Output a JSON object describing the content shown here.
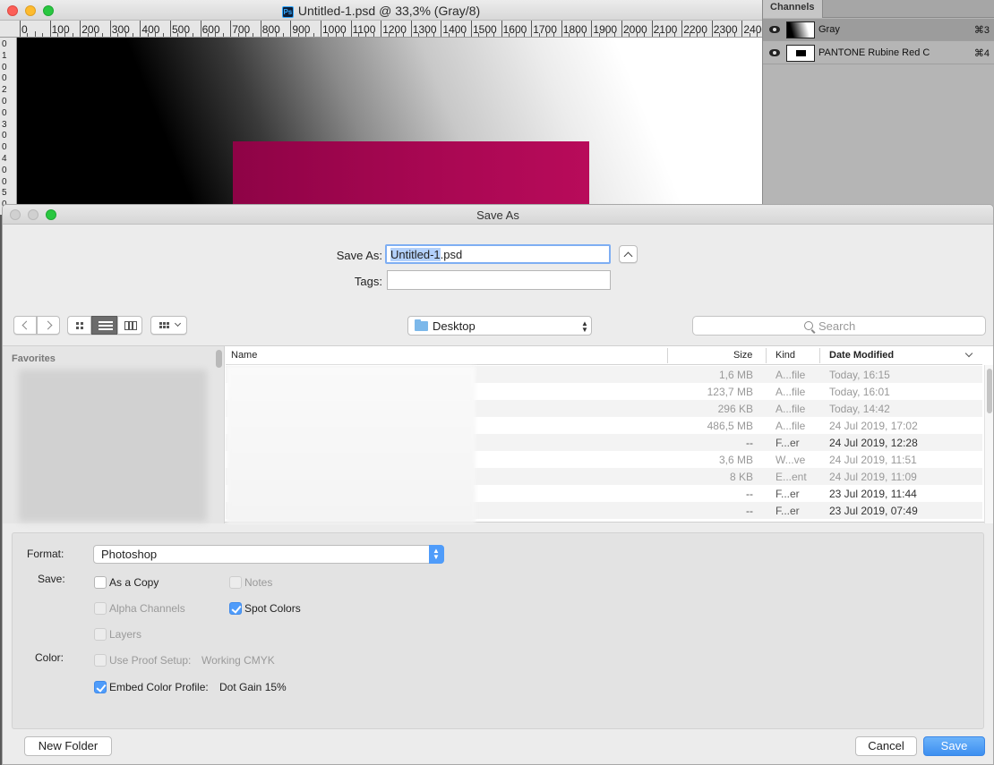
{
  "ps_window": {
    "title": "Untitled-1.psd @ 33,3% (Gray/8)",
    "app_icon_text": "Ps",
    "ruler_top": [
      "0",
      "100",
      "200",
      "300",
      "400",
      "500",
      "600",
      "700",
      "800",
      "900",
      "1000",
      "1100",
      "1200",
      "1300",
      "1400",
      "1500",
      "1600",
      "1700",
      "1800",
      "1900",
      "2000",
      "2100",
      "2200",
      "2300",
      "2400"
    ],
    "ruler_left": [
      "0",
      "1",
      "0",
      "0",
      "2",
      "0",
      "0",
      "3",
      "0",
      "0",
      "4",
      "0",
      "0",
      "5",
      "0"
    ],
    "spot_color": "#a80752"
  },
  "channels_panel": {
    "tab": "Channels",
    "rows": [
      {
        "name": "Gray",
        "shortcut": "⌘3"
      },
      {
        "name": "PANTONE Rubine Red C",
        "shortcut": "⌘4"
      }
    ]
  },
  "dialog": {
    "title": "Save As",
    "save_as_label": "Save As:",
    "filename_selected": "Untitled-1",
    "filename_rest": ".psd",
    "tags_label": "Tags:",
    "tags_value": "",
    "expand_icon": "chevron-up-icon",
    "location": "Desktop",
    "search_placeholder": "Search",
    "sidebar_header": "Favorites",
    "columns": {
      "name": "Name",
      "size": "Size",
      "kind": "Kind",
      "date": "Date Modified"
    },
    "files": [
      {
        "size": "1,6 MB",
        "kind": "A...file",
        "date": "Today, 16:15"
      },
      {
        "size": "123,7 MB",
        "kind": "A...file",
        "date": "Today, 16:01"
      },
      {
        "size": "296 KB",
        "kind": "A...file",
        "date": "Today, 14:42"
      },
      {
        "size": "486,5 MB",
        "kind": "A...file",
        "date": "24 Jul 2019, 17:02"
      },
      {
        "size": "--",
        "kind": "F...er",
        "date": "24 Jul 2019, 12:28"
      },
      {
        "size": "3,6 MB",
        "kind": "W...ve",
        "date": "24 Jul 2019, 11:51"
      },
      {
        "size": "8 KB",
        "kind": "E...ent",
        "date": "24 Jul 2019, 11:09"
      },
      {
        "size": "--",
        "kind": "F...er",
        "date": "23 Jul 2019, 11:44"
      },
      {
        "size": "--",
        "kind": "F...er",
        "date": "23 Jul 2019, 07:49"
      }
    ],
    "options": {
      "format_label": "Format:",
      "format_value": "Photoshop",
      "save_label": "Save:",
      "color_label": "Color:",
      "as_a_copy": "As a Copy",
      "notes": "Notes",
      "alpha_channels": "Alpha Channels",
      "spot_colors": "Spot Colors",
      "layers": "Layers",
      "use_proof_setup": "Use Proof Setup:",
      "proof_value": "Working CMYK",
      "embed_color_profile": "Embed Color Profile:",
      "profile_value": "Dot Gain 15%"
    },
    "new_folder": "New Folder",
    "cancel": "Cancel",
    "save": "Save"
  }
}
